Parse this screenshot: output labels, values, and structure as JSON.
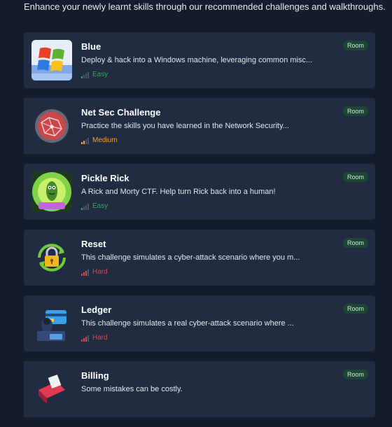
{
  "header": {
    "subtitle": "Enhance your newly learnt skills through our recommended challenges and walkthroughs."
  },
  "colors": {
    "background": "#151c2b",
    "card": "#212c42",
    "easy": "#2bb24c",
    "medium": "#f5a623",
    "hard": "#e0424f",
    "badge_bg": "#1d4634"
  },
  "rooms": [
    {
      "title": "Blue",
      "description": "Deploy & hack into a Windows machine, leveraging common misc...",
      "difficulty": "Easy",
      "badge": "Room",
      "icon": "windows-logo-icon"
    },
    {
      "title": "Net Sec Challenge",
      "description": "Practice the skills you have learned in the Network Security...",
      "difficulty": "Medium",
      "badge": "Room",
      "icon": "red-network-sphere-icon"
    },
    {
      "title": "Pickle Rick",
      "description": "A Rick and Morty CTF. Help turn Rick back into a human!",
      "difficulty": "Easy",
      "badge": "Room",
      "icon": "pickle-rick-portal-icon"
    },
    {
      "title": "Reset",
      "description": "This challenge simulates a cyber-attack scenario where you m...",
      "difficulty": "Hard",
      "badge": "Room",
      "icon": "padlock-reset-icon"
    },
    {
      "title": "Ledger",
      "description": "This challenge simulates a real cyber-attack scenario where ...",
      "difficulty": "Hard",
      "badge": "Room",
      "icon": "credit-card-hacker-icon"
    },
    {
      "title": "Billing",
      "description": "Some mistakes can be costly.",
      "difficulty": "",
      "badge": "Room",
      "icon": "billing-printer-icon"
    }
  ]
}
